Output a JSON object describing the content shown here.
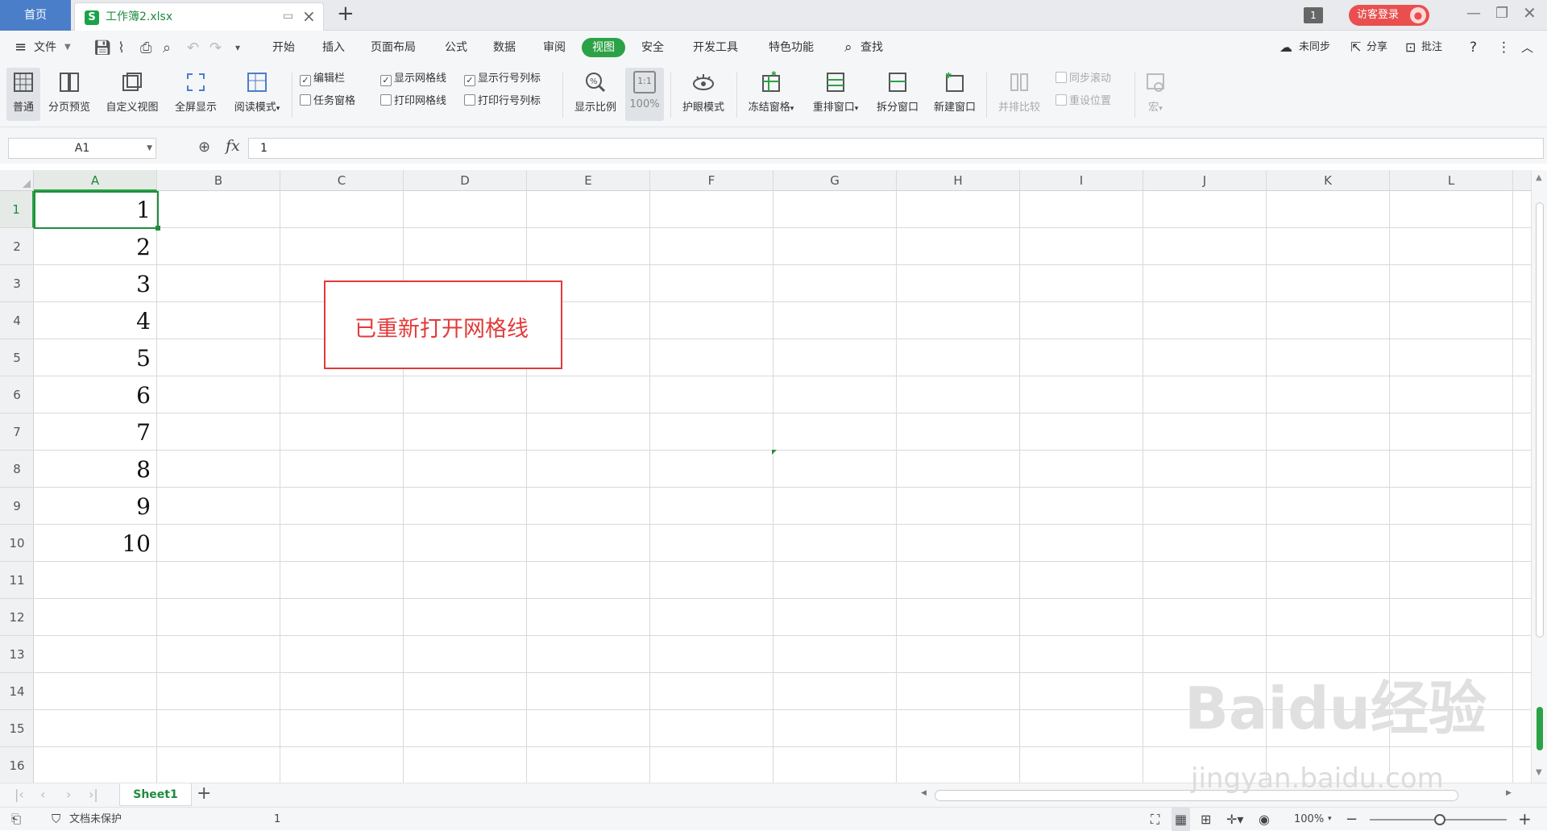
{
  "tabs": {
    "home": "首页",
    "file": "工作簿2.xlsx",
    "file_icon": "S",
    "window_count": "1",
    "login": "访客登录"
  },
  "menu": {
    "file": "文件",
    "items": [
      "开始",
      "插入",
      "页面布局",
      "公式",
      "数据",
      "审阅",
      "视图",
      "安全",
      "开发工具",
      "特色功能"
    ],
    "active": "视图",
    "search": "查找",
    "sync": "未同步",
    "share": "分享",
    "comment": "批注"
  },
  "ribbon": {
    "normal": "普通",
    "page_break": "分页预览",
    "custom_view": "自定义视图",
    "fullscreen": "全屏显示",
    "reading": "阅读模式",
    "formula_bar": "编辑栏",
    "task_pane": "任务窗格",
    "show_grid": "显示网格线",
    "print_grid": "打印网格线",
    "show_headings": "显示行号列标",
    "print_headings": "打印行号列标",
    "zoom": "显示比例",
    "zoom100_icon": "1:1",
    "zoom100": "100%",
    "eye": "护眼模式",
    "freeze": "冻结窗格",
    "arrange": "重排窗口",
    "split": "拆分窗口",
    "new_window": "新建窗口",
    "compare": "并排比较",
    "sync_scroll": "同步滚动",
    "reset_pos": "重设位置",
    "macro": "宏",
    "checks": {
      "formula_bar": true,
      "task_pane": false,
      "show_grid": true,
      "print_grid": false,
      "show_headings": true,
      "print_headings": false
    }
  },
  "formula": {
    "cell_ref": "A1",
    "fx": "fx",
    "value": "1"
  },
  "grid": {
    "columns": [
      "A",
      "B",
      "C",
      "D",
      "E",
      "F",
      "G",
      "H",
      "I",
      "J",
      "K",
      "L"
    ],
    "rows": [
      "1",
      "2",
      "3",
      "4",
      "5",
      "6",
      "7",
      "8",
      "9",
      "10",
      "11",
      "12",
      "13",
      "14",
      "15",
      "16"
    ],
    "col_a_values": [
      "1",
      "2",
      "3",
      "4",
      "5",
      "6",
      "7",
      "8",
      "9",
      "10"
    ]
  },
  "annotation": "已重新打开网格线",
  "sheets": {
    "active": "Sheet1"
  },
  "status": {
    "protect": "文档未保护",
    "value": "1",
    "zoom": "100%"
  },
  "watermark": {
    "logo": "Baidu经验",
    "url": "jingyan.baidu.com"
  },
  "colors": {
    "accent": "#2ba245",
    "home_tab": "#4a7ec9",
    "login": "#e94f4f",
    "annotation": "#e23a3a"
  }
}
